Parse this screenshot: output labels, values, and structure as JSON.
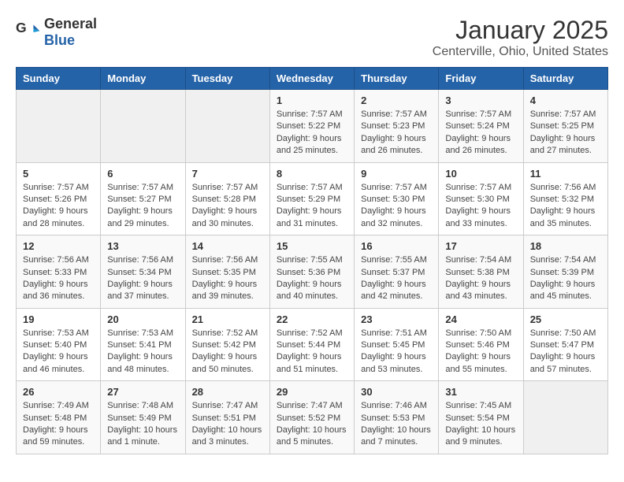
{
  "header": {
    "logo": {
      "general": "General",
      "blue": "Blue"
    },
    "title": "January 2025",
    "location": "Centerville, Ohio, United States"
  },
  "calendar": {
    "days_of_week": [
      "Sunday",
      "Monday",
      "Tuesday",
      "Wednesday",
      "Thursday",
      "Friday",
      "Saturday"
    ],
    "weeks": [
      [
        {
          "day": "",
          "info": ""
        },
        {
          "day": "",
          "info": ""
        },
        {
          "day": "",
          "info": ""
        },
        {
          "day": "1",
          "info": "Sunrise: 7:57 AM\nSunset: 5:22 PM\nDaylight: 9 hours\nand 25 minutes."
        },
        {
          "day": "2",
          "info": "Sunrise: 7:57 AM\nSunset: 5:23 PM\nDaylight: 9 hours\nand 26 minutes."
        },
        {
          "day": "3",
          "info": "Sunrise: 7:57 AM\nSunset: 5:24 PM\nDaylight: 9 hours\nand 26 minutes."
        },
        {
          "day": "4",
          "info": "Sunrise: 7:57 AM\nSunset: 5:25 PM\nDaylight: 9 hours\nand 27 minutes."
        }
      ],
      [
        {
          "day": "5",
          "info": "Sunrise: 7:57 AM\nSunset: 5:26 PM\nDaylight: 9 hours\nand 28 minutes."
        },
        {
          "day": "6",
          "info": "Sunrise: 7:57 AM\nSunset: 5:27 PM\nDaylight: 9 hours\nand 29 minutes."
        },
        {
          "day": "7",
          "info": "Sunrise: 7:57 AM\nSunset: 5:28 PM\nDaylight: 9 hours\nand 30 minutes."
        },
        {
          "day": "8",
          "info": "Sunrise: 7:57 AM\nSunset: 5:29 PM\nDaylight: 9 hours\nand 31 minutes."
        },
        {
          "day": "9",
          "info": "Sunrise: 7:57 AM\nSunset: 5:30 PM\nDaylight: 9 hours\nand 32 minutes."
        },
        {
          "day": "10",
          "info": "Sunrise: 7:57 AM\nSunset: 5:30 PM\nDaylight: 9 hours\nand 33 minutes."
        },
        {
          "day": "11",
          "info": "Sunrise: 7:56 AM\nSunset: 5:32 PM\nDaylight: 9 hours\nand 35 minutes."
        }
      ],
      [
        {
          "day": "12",
          "info": "Sunrise: 7:56 AM\nSunset: 5:33 PM\nDaylight: 9 hours\nand 36 minutes."
        },
        {
          "day": "13",
          "info": "Sunrise: 7:56 AM\nSunset: 5:34 PM\nDaylight: 9 hours\nand 37 minutes."
        },
        {
          "day": "14",
          "info": "Sunrise: 7:56 AM\nSunset: 5:35 PM\nDaylight: 9 hours\nand 39 minutes."
        },
        {
          "day": "15",
          "info": "Sunrise: 7:55 AM\nSunset: 5:36 PM\nDaylight: 9 hours\nand 40 minutes."
        },
        {
          "day": "16",
          "info": "Sunrise: 7:55 AM\nSunset: 5:37 PM\nDaylight: 9 hours\nand 42 minutes."
        },
        {
          "day": "17",
          "info": "Sunrise: 7:54 AM\nSunset: 5:38 PM\nDaylight: 9 hours\nand 43 minutes."
        },
        {
          "day": "18",
          "info": "Sunrise: 7:54 AM\nSunset: 5:39 PM\nDaylight: 9 hours\nand 45 minutes."
        }
      ],
      [
        {
          "day": "19",
          "info": "Sunrise: 7:53 AM\nSunset: 5:40 PM\nDaylight: 9 hours\nand 46 minutes."
        },
        {
          "day": "20",
          "info": "Sunrise: 7:53 AM\nSunset: 5:41 PM\nDaylight: 9 hours\nand 48 minutes."
        },
        {
          "day": "21",
          "info": "Sunrise: 7:52 AM\nSunset: 5:42 PM\nDaylight: 9 hours\nand 50 minutes."
        },
        {
          "day": "22",
          "info": "Sunrise: 7:52 AM\nSunset: 5:44 PM\nDaylight: 9 hours\nand 51 minutes."
        },
        {
          "day": "23",
          "info": "Sunrise: 7:51 AM\nSunset: 5:45 PM\nDaylight: 9 hours\nand 53 minutes."
        },
        {
          "day": "24",
          "info": "Sunrise: 7:50 AM\nSunset: 5:46 PM\nDaylight: 9 hours\nand 55 minutes."
        },
        {
          "day": "25",
          "info": "Sunrise: 7:50 AM\nSunset: 5:47 PM\nDaylight: 9 hours\nand 57 minutes."
        }
      ],
      [
        {
          "day": "26",
          "info": "Sunrise: 7:49 AM\nSunset: 5:48 PM\nDaylight: 9 hours\nand 59 minutes."
        },
        {
          "day": "27",
          "info": "Sunrise: 7:48 AM\nSunset: 5:49 PM\nDaylight: 10 hours\nand 1 minute."
        },
        {
          "day": "28",
          "info": "Sunrise: 7:47 AM\nSunset: 5:51 PM\nDaylight: 10 hours\nand 3 minutes."
        },
        {
          "day": "29",
          "info": "Sunrise: 7:47 AM\nSunset: 5:52 PM\nDaylight: 10 hours\nand 5 minutes."
        },
        {
          "day": "30",
          "info": "Sunrise: 7:46 AM\nSunset: 5:53 PM\nDaylight: 10 hours\nand 7 minutes."
        },
        {
          "day": "31",
          "info": "Sunrise: 7:45 AM\nSunset: 5:54 PM\nDaylight: 10 hours\nand 9 minutes."
        },
        {
          "day": "",
          "info": ""
        }
      ]
    ]
  }
}
